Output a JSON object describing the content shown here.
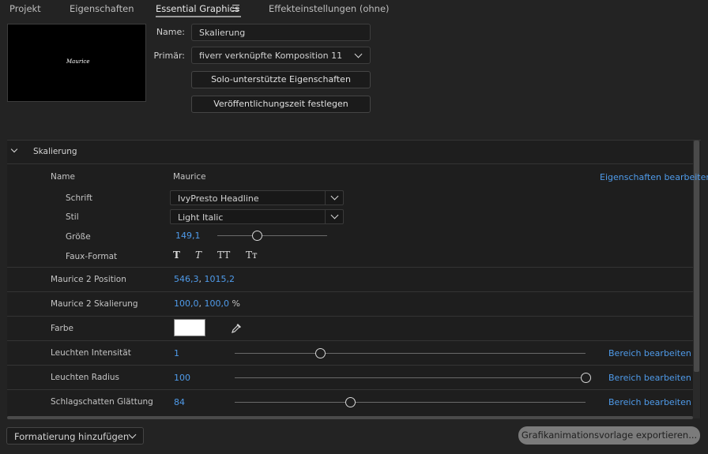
{
  "tabs": [
    {
      "label": "Projekt"
    },
    {
      "label": "Eigenschaften"
    },
    {
      "label": "Essential Graphics"
    },
    {
      "label": "Effekteinstellungen (ohne)"
    }
  ],
  "preview": {
    "text": "Maurice"
  },
  "form": {
    "name_label": "Name:",
    "name_value": "Skalierung",
    "primary_label": "Primär:",
    "primary_value": "fiverr verknüpfte Komposition 11",
    "solo_button": "Solo-unterstützte Eigenschaften",
    "publish_button": "Veröffentlichungszeit festlegen"
  },
  "section": {
    "title": "Skalierung"
  },
  "text_layer": {
    "name_label": "Name",
    "name_value": "Maurice",
    "edit_link": "Eigenschaften bearbeiten",
    "font_label": "Schrift",
    "font_value": "IvyPresto Headline",
    "style_label": "Stil",
    "style_value": "Light Italic",
    "size_label": "Größe",
    "size_value": "149,1",
    "size_slider": 0.36,
    "faux_label": "Faux-Format",
    "faux_buttons": [
      "T",
      "T",
      "TT",
      "Tт"
    ]
  },
  "properties": {
    "position_label": "Maurice 2 Position",
    "position_x": "546,3",
    "position_sep": ",",
    "position_y": "1015,2",
    "scale_label": "Maurice 2 Skalierung",
    "scale_x": "100,0",
    "scale_sep": ",",
    "scale_y": "100,0",
    "scale_unit": "%",
    "color_label": "Farbe",
    "color_value": "#ffffff",
    "glow_intensity_label": "Leuchten Intensität",
    "glow_intensity_value": "1",
    "glow_intensity_slider": 0.245,
    "glow_radius_label": "Leuchten Radius",
    "glow_radius_value": "100",
    "glow_radius_slider": 1.0,
    "shadow_label": "Schlagschatten Glättung",
    "shadow_value": "84",
    "shadow_slider": 0.33,
    "range_link": "Bereich bearbeiten"
  },
  "bottom": {
    "add_format": "Formatierung hinzufügen",
    "export_button": "Grafikanimationsvorlage exportieren..."
  },
  "colors": {
    "accent": "#4f9bea",
    "background": "#232323",
    "panel": "#1e1e1e"
  }
}
